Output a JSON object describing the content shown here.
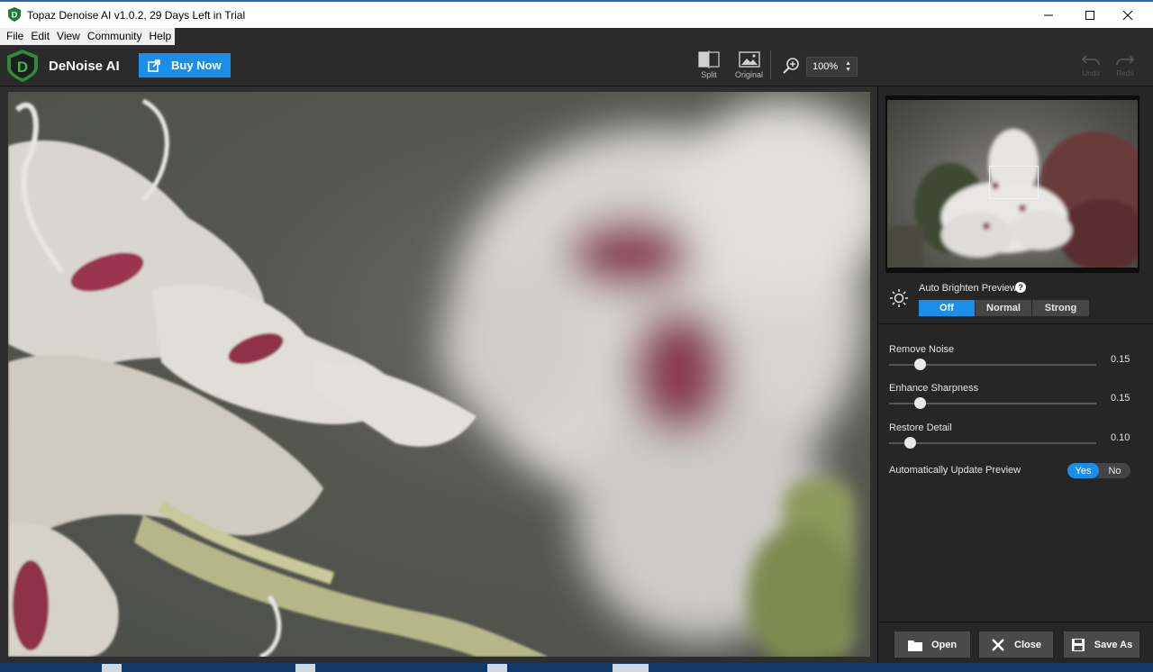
{
  "window": {
    "title": "Topaz Denoise AI v1.0.2, 29 Days Left in Trial",
    "minimize_icon": "minimize-icon",
    "maximize_icon": "maximize-icon",
    "close_icon": "close-icon"
  },
  "menu": {
    "items": [
      "File",
      "Edit",
      "View",
      "Community",
      "Help"
    ]
  },
  "toolbar": {
    "brand": "DeNoise AI",
    "buy_label": "Buy Now",
    "split_label": "Split",
    "original_label": "Original",
    "zoom_value": "100%",
    "undo_label": "Undo",
    "redo_label": "Redo"
  },
  "panel": {
    "brighten": {
      "label": "Auto Brighten Preview",
      "options": [
        "Off",
        "Normal",
        "Strong"
      ],
      "selected": "Off"
    },
    "sliders": [
      {
        "label": "Remove Noise",
        "value": "0.15",
        "fraction": 0.15
      },
      {
        "label": "Enhance Sharpness",
        "value": "0.15",
        "fraction": 0.15
      },
      {
        "label": "Restore Detail",
        "value": "0.10",
        "fraction": 0.1
      }
    ],
    "auto_update": {
      "label": "Automatically Update Preview",
      "yes": "Yes",
      "no": "No",
      "selected": "Yes"
    },
    "buttons": {
      "open": "Open",
      "close": "Close",
      "save_as": "Save As"
    }
  },
  "colors": {
    "accent": "#1a8ee8",
    "toolbar_bg": "#2b2b2b",
    "panel_bg": "#262626",
    "brand_green": "#2e8b3a"
  }
}
